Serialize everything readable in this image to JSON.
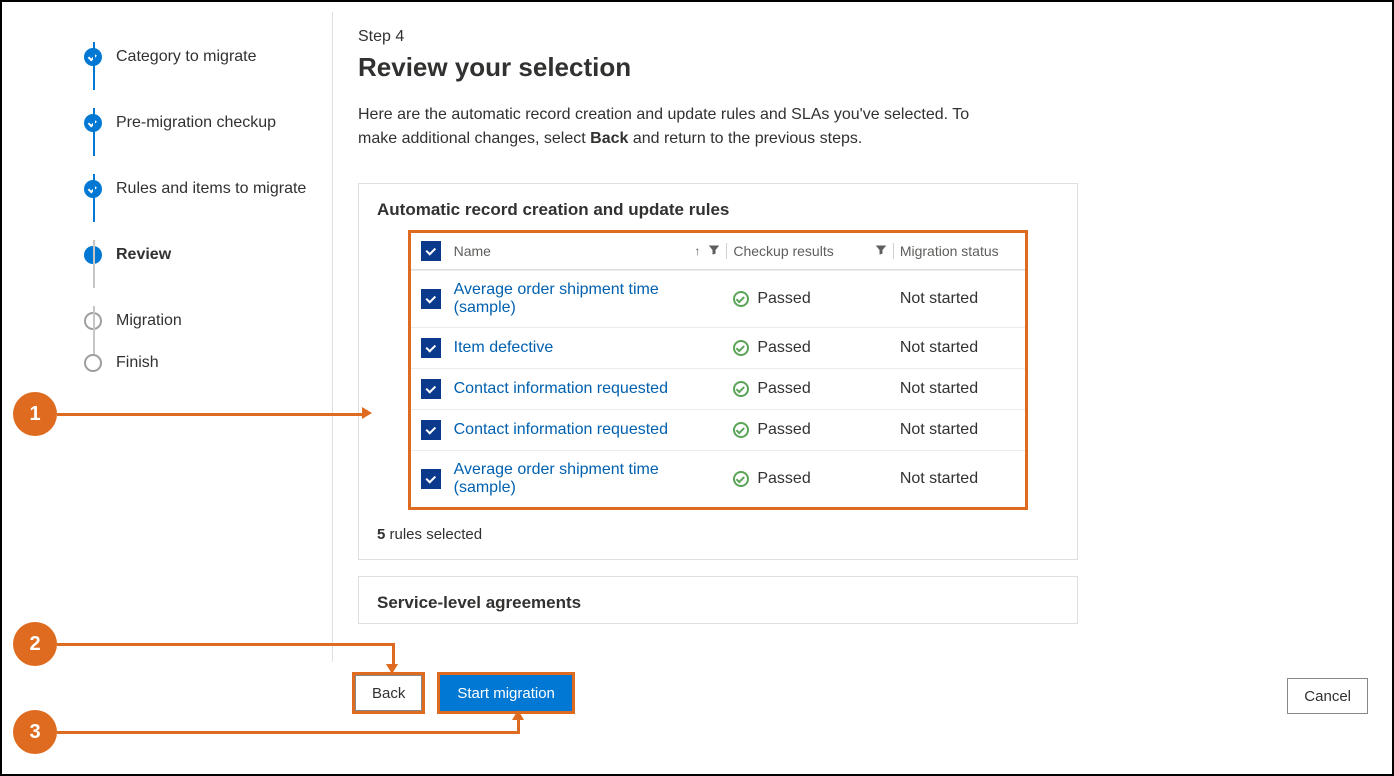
{
  "stepper": {
    "items": [
      {
        "label": "Category to migrate",
        "state": "checked"
      },
      {
        "label": "Pre-migration checkup",
        "state": "checked"
      },
      {
        "label": "Rules and items to migrate",
        "state": "checked"
      },
      {
        "label": "Review",
        "state": "current"
      },
      {
        "label": "Migration",
        "state": "pending"
      },
      {
        "label": "Finish",
        "state": "pending"
      }
    ]
  },
  "header": {
    "step_label": "Step 4",
    "title": "Review your selection",
    "desc_before": "Here are the automatic record creation and update rules and SLAs you've selected. To make additional changes, select ",
    "desc_bold": "Back",
    "desc_after": " and return to the previous steps."
  },
  "rules_panel": {
    "title": "Automatic record creation and update rules",
    "columns": {
      "name": "Name",
      "checkup": "Checkup results",
      "migration": "Migration status"
    },
    "rows": [
      {
        "name": "Average order shipment time (sample)",
        "checkup": "Passed",
        "migration": "Not started"
      },
      {
        "name": "Item defective",
        "checkup": "Passed",
        "migration": "Not started"
      },
      {
        "name": "Contact information requested",
        "checkup": "Passed",
        "migration": "Not started"
      },
      {
        "name": "Contact information requested",
        "checkup": "Passed",
        "migration": "Not started"
      },
      {
        "name": "Average order shipment time (sample)",
        "checkup": "Passed",
        "migration": "Not started"
      }
    ],
    "count_num": "5",
    "count_text": " rules selected"
  },
  "sla_panel": {
    "title": "Service-level agreements"
  },
  "buttons": {
    "back": "Back",
    "start": "Start migration",
    "cancel": "Cancel"
  },
  "callouts": {
    "one": "1",
    "two": "2",
    "three": "3"
  }
}
